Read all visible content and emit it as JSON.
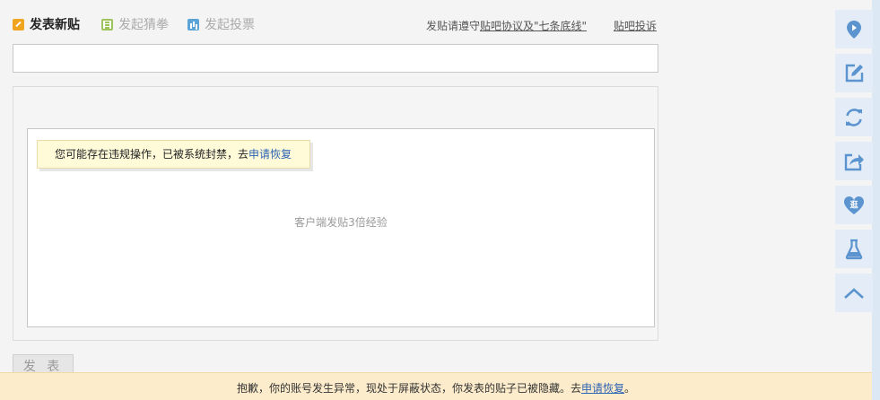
{
  "tabs": {
    "new_post": "发表新贴",
    "guess": "发起猜拳",
    "vote": "发起投票"
  },
  "rules": {
    "prefix": "发贴请遵守",
    "link": "贴吧协议及\"七条底线\"",
    "complain": "贴吧投诉"
  },
  "title_input": {
    "value": "",
    "placeholder": ""
  },
  "editor": {
    "ban_tip_text": "您可能存在违规操作，已被系统封禁，去",
    "ban_tip_link": "申请恢复",
    "client_hint": "客户端发贴3倍经验"
  },
  "publish_button": "发 表",
  "notice": {
    "text": "抱歉，你的账号发生异常，现处于屏蔽状态，你发表的贴子已被隐藏。去",
    "link": "申请恢复",
    "suffix": "。"
  },
  "sidebar": {
    "items": [
      {
        "icon": "location-pin-icon"
      },
      {
        "icon": "edit-icon"
      },
      {
        "icon": "refresh-icon"
      },
      {
        "icon": "share-icon"
      },
      {
        "icon": "heart-stroll-icon",
        "glyph": "逛"
      },
      {
        "icon": "flask-icon"
      },
      {
        "icon": "back-to-top-icon"
      }
    ]
  },
  "colors": {
    "accent": "#5b94cf",
    "link": "#2d64b3",
    "notice_bg": "#fdeccb",
    "tip_bg": "#fffbd9"
  }
}
